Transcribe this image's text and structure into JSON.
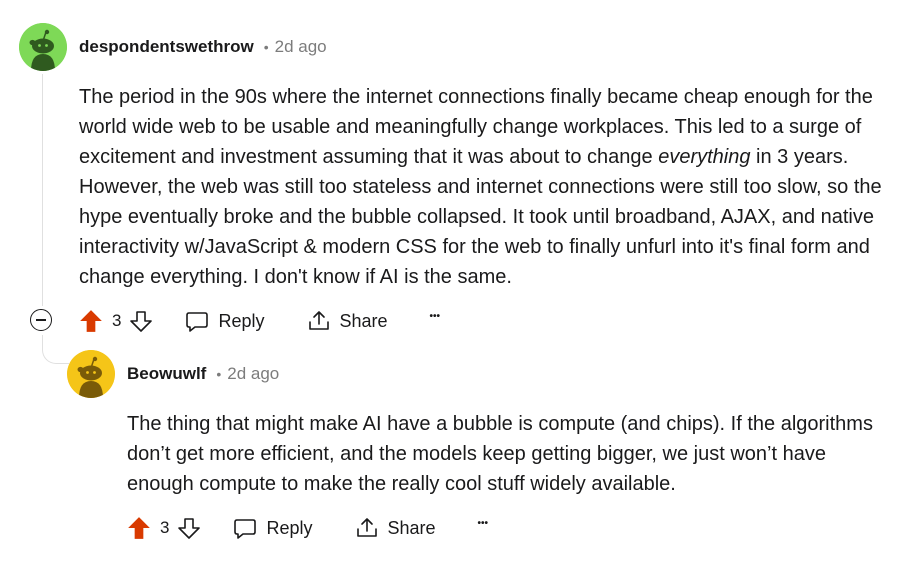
{
  "colors": {
    "upvote_active": "#d93a00",
    "avatar_green": "#7ed957",
    "avatar_yellow": "#f5c518",
    "muted_text": "#7c7c7c"
  },
  "comments": [
    {
      "username": "despondentswethrow",
      "separator": "•",
      "time": "2d ago",
      "avatar_icon": "snoo-avatar-green",
      "body_parts": {
        "p1": "The period in the 90s where the internet connections finally became cheap enough for the world wide web to be usable and meaningfully change workplaces. This led to a surge of excitement and investment assuming that it was about to change ",
        "em": "everything",
        "p2": " in 3 years. However, the web was still too stateless and internet connections were still too slow, so the hype eventually broke and the bubble collapsed. It took until broadband, AJAX, and native interactivity w/JavaScript & modern CSS for the web to finally unfurl into it's final form and change everything. I don't know if AI is the same."
      },
      "score": "3",
      "reply_label": "Reply",
      "share_label": "Share",
      "more_label": "•••"
    },
    {
      "username": "Beowuwlf",
      "separator": "•",
      "time": "2d ago",
      "avatar_icon": "snoo-avatar-yellow",
      "body": "The thing that might make AI have a bubble is compute (and chips). If the algorithms don’t get more efficient, and the models keep getting bigger, we just won’t have enough compute to make the really cool stuff widely available.",
      "score": "3",
      "reply_label": "Reply",
      "share_label": "Share",
      "more_label": "•••"
    }
  ]
}
